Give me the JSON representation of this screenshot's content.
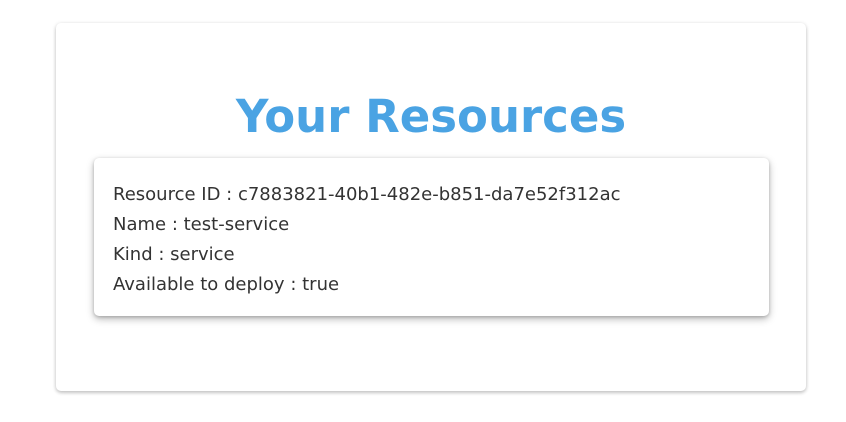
{
  "page": {
    "title": "Your Resources"
  },
  "resource": {
    "fields": [
      {
        "label": "Resource ID",
        "value": "c7883821-40b1-482e-b851-da7e52f312ac"
      },
      {
        "label": "Name",
        "value": "test-service"
      },
      {
        "label": "Kind",
        "value": "service"
      },
      {
        "label": "Available to deploy",
        "value": "true"
      }
    ]
  },
  "colors": {
    "title": "#4aa3e3",
    "text": "#333333",
    "card_background": "#ffffff"
  }
}
